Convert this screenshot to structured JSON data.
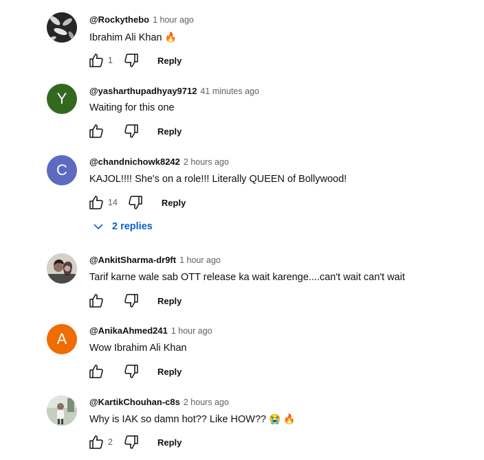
{
  "comments": [
    {
      "author": "@Rockythebo",
      "time": "1 hour ago",
      "text": "Ibrahim Ali Khan",
      "emoji": "🔥",
      "likes": "1",
      "reply_label": "Reply",
      "avatar": {
        "type": "image",
        "bg": "#2b2b2b",
        "icon": "leaf-pattern-avatar"
      }
    },
    {
      "author": "@yasharthupadhyay9712",
      "time": "41 minutes ago",
      "text": "Waiting for this one",
      "emoji": "",
      "likes": "",
      "reply_label": "Reply",
      "avatar": {
        "type": "letter",
        "letter": "Y",
        "bg": "#33691e"
      }
    },
    {
      "author": "@chandnichowk8242",
      "time": "2 hours ago",
      "text": "KAJOL!!!! She's on a role!!! Literally QUEEN of Bollywood!",
      "emoji": "",
      "likes": "14",
      "reply_label": "Reply",
      "avatar": {
        "type": "letter",
        "letter": "C",
        "bg": "#5c6bc0"
      },
      "replies_label": "2 replies"
    },
    {
      "author": "@AnkitSharma-dr9ft",
      "time": "1 hour ago",
      "text": "Tarif karne wale sab OTT release ka wait karenge....can't wait can't wait",
      "emoji": "",
      "likes": "",
      "reply_label": "Reply",
      "avatar": {
        "type": "image",
        "bg": "#c9c4bc",
        "icon": "couple-photo-avatar"
      }
    },
    {
      "author": "@AnikaAhmed241",
      "time": "1 hour ago",
      "text": "Wow Ibrahim Ali Khan",
      "emoji": "",
      "likes": "",
      "reply_label": "Reply",
      "avatar": {
        "type": "letter",
        "letter": "A",
        "bg": "#ef6c00"
      }
    },
    {
      "author": "@KartikChouhan-c8s",
      "time": "2 hours ago",
      "text": "Why is IAK so damn hot?? Like HOW??",
      "emoji": "😭 🔥",
      "likes": "2",
      "reply_label": "Reply",
      "avatar": {
        "type": "image",
        "bg": "#b8c2b4",
        "icon": "outdoor-photo-avatar"
      }
    }
  ],
  "colors": {
    "link_blue": "#065fd4",
    "secondary_text": "#606060"
  },
  "icons": {
    "like": "thumbs-up-icon",
    "dislike": "thumbs-down-icon",
    "expand": "chevron-down-icon"
  }
}
